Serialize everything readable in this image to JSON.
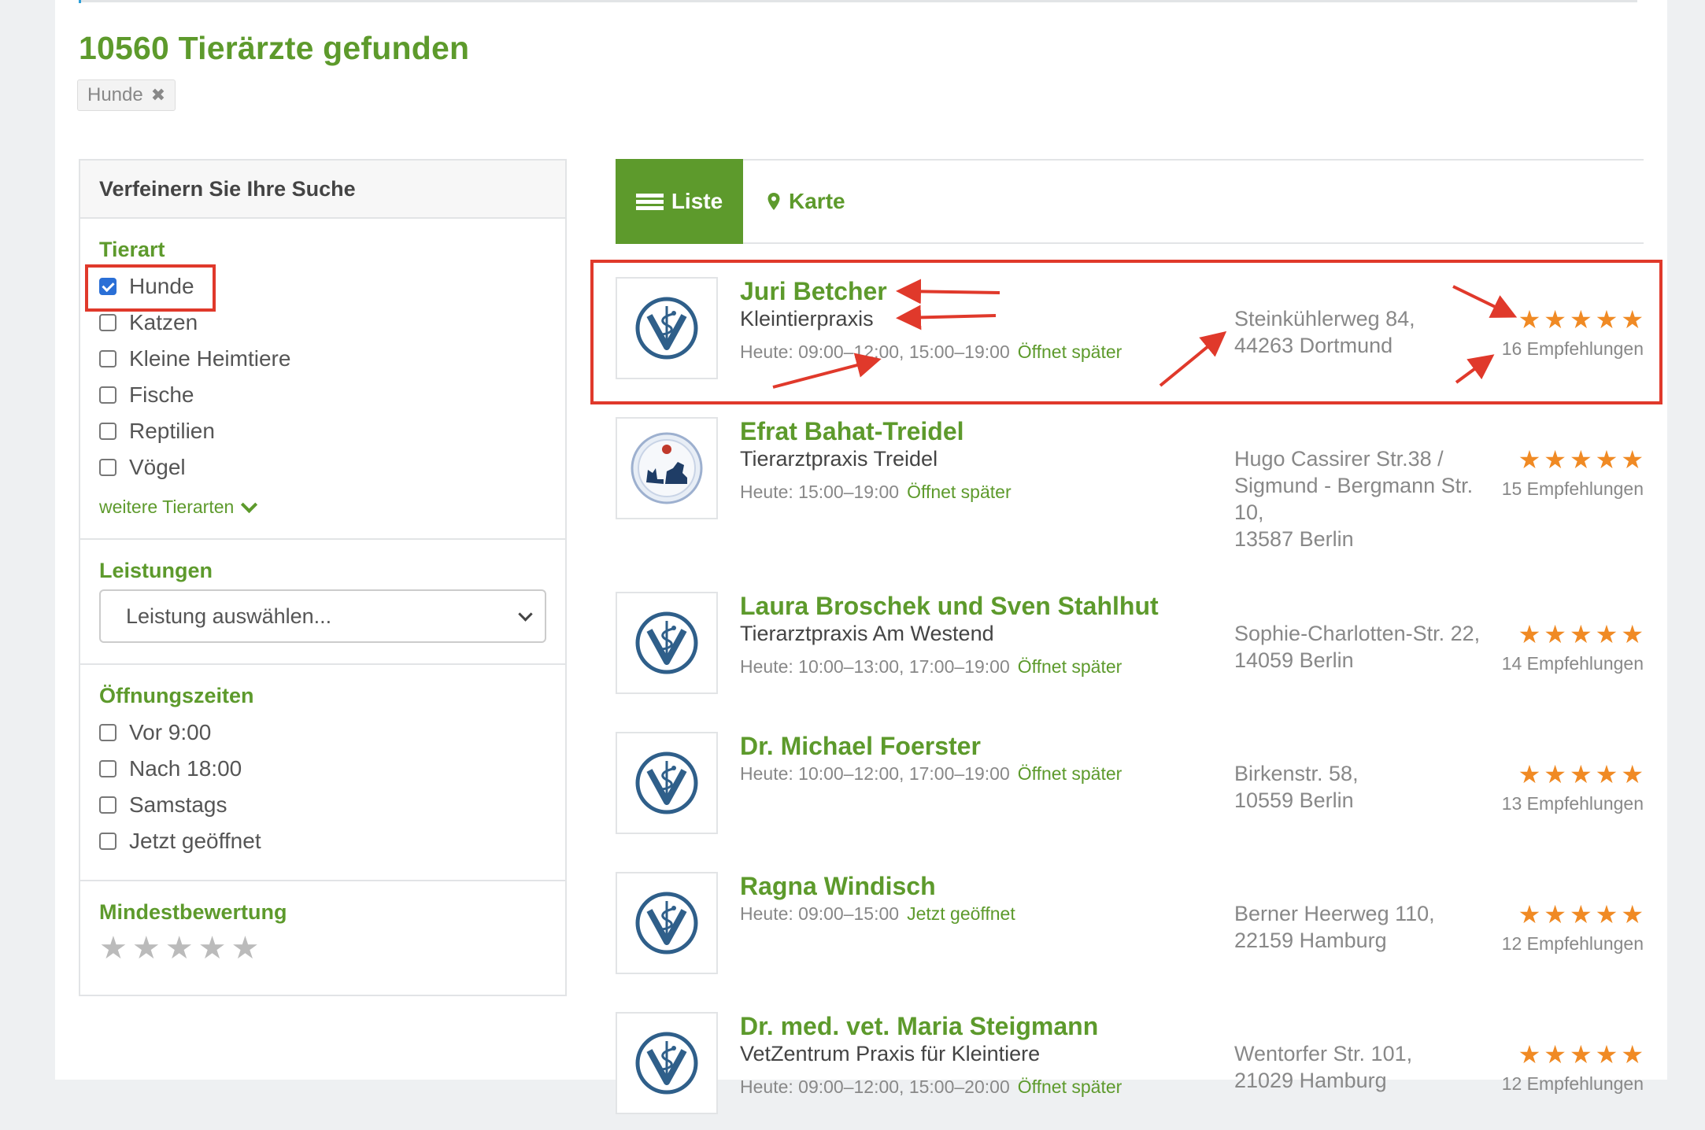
{
  "header": {
    "result_count_title": "10560 Tierärzte gefunden",
    "active_filter_tag": "Hunde",
    "remove_icon": "close-icon"
  },
  "sidebar": {
    "title": "Verfeinern Sie Ihre Suche",
    "tierart": {
      "title": "Tierart",
      "options": [
        {
          "label": "Hunde",
          "checked": true
        },
        {
          "label": "Katzen",
          "checked": false
        },
        {
          "label": "Kleine Heimtiere",
          "checked": false
        },
        {
          "label": "Fische",
          "checked": false
        },
        {
          "label": "Reptilien",
          "checked": false
        },
        {
          "label": "Vögel",
          "checked": false
        }
      ],
      "more_link": "weitere Tierarten"
    },
    "leistungen": {
      "title": "Leistungen",
      "select_value": "Leistung auswählen..."
    },
    "oeffnungszeiten": {
      "title": "Öffnungszeiten",
      "options": [
        {
          "label": "Vor 9:00",
          "checked": false
        },
        {
          "label": "Nach 18:00",
          "checked": false
        },
        {
          "label": "Samstags",
          "checked": false
        },
        {
          "label": "Jetzt geöffnet",
          "checked": false
        }
      ]
    },
    "mindestbewertung": {
      "title": "Mindestbewertung",
      "stars": 5,
      "selected": 0
    }
  },
  "tabs": {
    "list_label": "Liste",
    "map_label": "Karte",
    "active": "list"
  },
  "results": [
    {
      "name": "Juri Betcher",
      "practice": "Kleintierpraxis",
      "hours": "Heute: 09:00–12:00, 15:00–19:00",
      "status": "Öffnet später",
      "address": [
        "Steinkühlerweg 84,",
        "44263 Dortmund"
      ],
      "rating": 5,
      "recommendations": "16 Empfehlungen",
      "logo": "vet-caduceus-icon"
    },
    {
      "name": "Efrat Bahat-Treidel",
      "practice": "Tierarztpraxis Treidel",
      "hours": "Heute: 15:00–19:00",
      "status": "Öffnet später",
      "address": [
        "Hugo Cassirer Str.38 /",
        "Sigmund - Bergmann Str.",
        "10,",
        "13587 Berlin"
      ],
      "rating": 5,
      "recommendations": "15 Empfehlungen",
      "logo": "cat-dog-logo"
    },
    {
      "name": "Laura Broschek und Sven Stahlhut",
      "practice": "Tierarztpraxis Am Westend",
      "hours": "Heute: 10:00–13:00, 17:00–19:00",
      "status": "Öffnet später",
      "address": [
        "Sophie-Charlotten-Str. 22,",
        "14059 Berlin"
      ],
      "rating": 5,
      "recommendations": "14 Empfehlungen",
      "logo": "vet-caduceus-icon"
    },
    {
      "name": "Dr. Michael Foerster",
      "practice": "",
      "hours": "Heute: 10:00–12:00, 17:00–19:00",
      "status": "Öffnet später",
      "address": [
        "Birkenstr. 58,",
        "10559 Berlin"
      ],
      "rating": 5,
      "recommendations": "13 Empfehlungen",
      "logo": "vet-caduceus-icon"
    },
    {
      "name": "Ragna Windisch",
      "practice": "",
      "hours": "Heute: 09:00–15:00",
      "status": "Jetzt geöffnet",
      "address": [
        "Berner Heerweg 110,",
        "22159 Hamburg"
      ],
      "rating": 5,
      "recommendations": "12 Empfehlungen",
      "logo": "vet-caduceus-icon"
    },
    {
      "name": "Dr. med. vet. Maria Steigmann",
      "practice": "VetZentrum Praxis für Kleintiere",
      "hours": "Heute: 09:00–12:00, 15:00–20:00",
      "status": "Öffnet später",
      "address": [
        "Wentorfer Str. 101,",
        "21029 Hamburg"
      ],
      "rating": 5,
      "recommendations": "12 Empfehlungen",
      "logo": "vet-caduceus-icon"
    }
  ],
  "colors": {
    "brand_green": "#5d9a2c",
    "star_orange": "#f08a24",
    "annotation_red": "#e0392b",
    "vet_logo_blue": "#2f5f8a"
  }
}
